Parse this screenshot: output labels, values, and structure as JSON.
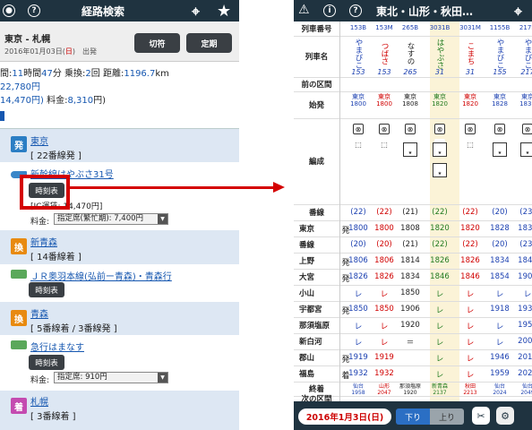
{
  "left": {
    "title": "経路検索",
    "route": "東京 - 札幌",
    "date_main": "2016年01月03日(",
    "date_sun": "日",
    "date_tail": ")　出発",
    "btn_kippu": "切符",
    "btn_teiki": "定期",
    "sum1_a": "間:",
    "sum1_b": "11",
    "sum1_c": "時間",
    "sum1_d": "47",
    "sum1_e": "分 乗換:",
    "sum1_f": "2",
    "sum1_g": "回 距離:",
    "sum1_h": "1196.7",
    "sum1_i": "km",
    "sum2": "22,780円",
    "sum3_a": "14,470円)",
    "sum3_b": " 料金:",
    "sum3_c": "8,310",
    "sum3_d": "円)",
    "segments": [
      {
        "icon": "発",
        "name": "東京",
        "sub": "[ 22番線発 ]"
      },
      {
        "name": "新幹線はやぶさ31号",
        "tbtn": "時刻表",
        "sub": "[IC運賃: 14,470円]",
        "fare_label": "料金:",
        "fare_sel": "指定席(繁忙期): 7,400円"
      },
      {
        "icon": "換",
        "name": "新青森",
        "sub": "[ 14番線着 ]"
      },
      {
        "name": "ＪＲ奥羽本線(弘前ー青森)・青森行",
        "tbtn": "時刻表"
      },
      {
        "icon": "換",
        "name": "青森",
        "sub": "[ 5番線着 / 3番線発 ]"
      },
      {
        "name": "急行はまなす",
        "tbtn": "時刻表",
        "fare_label": "料金:",
        "fare_sel": "指定席: 910円"
      },
      {
        "icon": "着",
        "name": "札幌",
        "sub": "[ 3番線着 ]"
      }
    ]
  },
  "right": {
    "title": "東北・山形・秋田…",
    "labels": [
      "列車番号",
      "列車名",
      "前の区間",
      "始発",
      "編成",
      "番線",
      "東京",
      "番線",
      "上野",
      "大宮",
      "小山",
      "宇都宮",
      "那須塩原",
      "新白河",
      "郡山",
      "福島",
      "終着",
      "次の区間"
    ],
    "dir": [
      "発",
      "",
      "",
      "発",
      "発",
      "",
      "",
      "",
      "発",
      "着"
    ],
    "cols": [
      {
        "num": "153B",
        "name": "やまびこ",
        "no": "153",
        "start": "東京\n1800",
        "platform": "(22)",
        "tokyo": "1800",
        "plat2": "(20)",
        "ueno": "1806",
        "omiya": "1826",
        "oyama": "レ",
        "utsu": "1850",
        "nasu": "レ",
        "shira": "レ",
        "kori": "1919",
        "fuku": "1932",
        "end": "仙台\n1958",
        "color": "blue"
      },
      {
        "num": "153M",
        "name": "つばさ",
        "no": "153",
        "start": "東京\n1800",
        "platform": "(22)",
        "tokyo": "1800",
        "plat2": "(20)",
        "ueno": "1806",
        "omiya": "1826",
        "oyama": "レ",
        "utsu": "1850",
        "nasu": "レ",
        "shira": "レ",
        "kori": "1919",
        "fuku": "1932",
        "end": "山形\n2047",
        "color": "red"
      },
      {
        "num": "265B",
        "name": "なすの",
        "no": "265",
        "start": "東京\n1808",
        "platform": "(21)",
        "tokyo": "1808",
        "plat2": "(21)",
        "ueno": "1814",
        "omiya": "1834",
        "oyama": "1850",
        "utsu": "1906",
        "nasu": "1920",
        "shira": "＝",
        "kori": "",
        "fuku": "",
        "end": "那須塩原\n1920",
        "color": "black"
      },
      {
        "num": "3031B",
        "name": "はやぶさ",
        "no": "31",
        "start": "東京\n1820",
        "platform": "(22)",
        "tokyo": "1820",
        "plat2": "(22)",
        "ueno": "1826",
        "omiya": "1846",
        "oyama": "レ",
        "utsu": "レ",
        "nasu": "レ",
        "shira": "レ",
        "kori": "レ",
        "fuku": "レ",
        "end": "新青森\n2137",
        "color": "green"
      },
      {
        "num": "3031M",
        "name": "こまち",
        "no": "31",
        "start": "東京\n1820",
        "platform": "(22)",
        "tokyo": "1820",
        "plat2": "(22)",
        "ueno": "1826",
        "omiya": "1846",
        "oyama": "レ",
        "utsu": "レ",
        "nasu": "レ",
        "shira": "レ",
        "kori": "レ",
        "fuku": "レ",
        "end": "秋田\n2213",
        "color": "red"
      },
      {
        "num": "1155B",
        "name": "やまびこ",
        "no": "155",
        "start": "東京\n1828",
        "platform": "(20)",
        "tokyo": "1828",
        "plat2": "(20)",
        "ueno": "1834",
        "omiya": "1854",
        "oyama": "レ",
        "utsu": "1918",
        "nasu": "レ",
        "shira": "レ",
        "kori": "1946",
        "fuku": "1959",
        "end": "仙台\n2024",
        "color": "blue"
      },
      {
        "num": "217B",
        "name": "やまびこ",
        "no": "217",
        "start": "東京\n1836",
        "platform": "(23)",
        "tokyo": "1836",
        "plat2": "(23)",
        "ueno": "1842",
        "omiya": "1902",
        "oyama": "レ",
        "utsu": "1932",
        "nasu": "1951",
        "shira": "2002",
        "kori": "2014",
        "fuku": "2027",
        "end": "仙台\n2049",
        "color": "blue"
      }
    ],
    "date": "2016年1月3日(日)",
    "down": "下り",
    "up": "上り"
  }
}
